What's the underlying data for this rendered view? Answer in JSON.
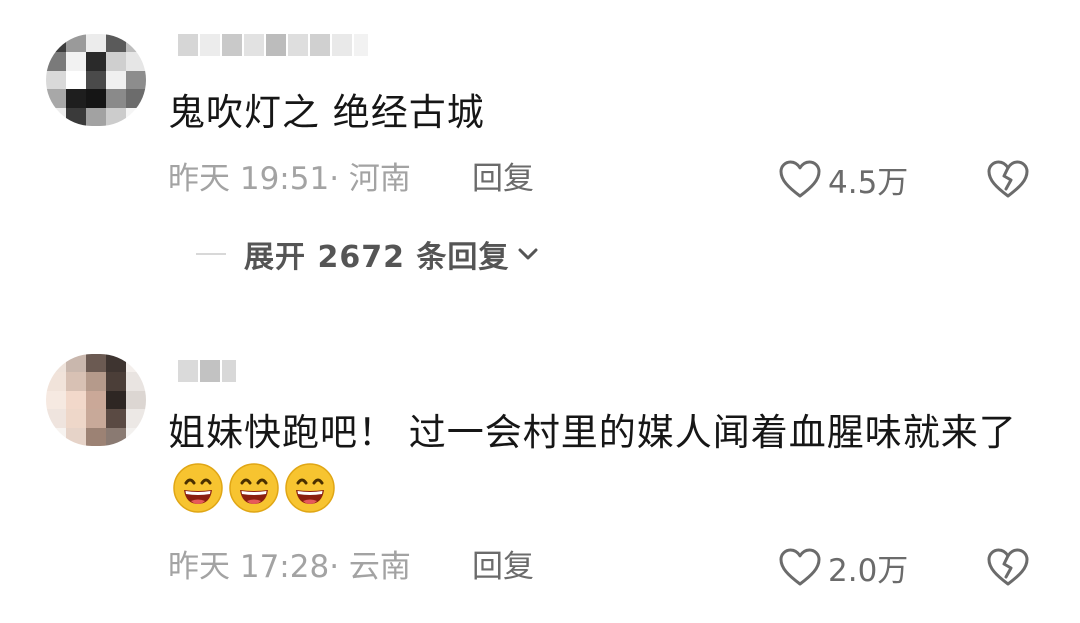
{
  "comments": [
    {
      "text": "鬼吹灯之 绝经古城",
      "time_location": "昨天 19:51· 河南",
      "reply_label": "回复",
      "like_count": "4.5万",
      "expand_label": "展开 2672 条回复"
    },
    {
      "text": "姐妹快跑吧！ 过一会村里的媒人闻着血腥味就来了",
      "emojis": [
        "grinning-face",
        "grinning-face",
        "grinning-face"
      ],
      "time_location": "昨天 17:28· 云南",
      "reply_label": "回复",
      "like_count": "2.0万"
    }
  ],
  "colors": {
    "text": "#161616",
    "meta": "#a3a3a3",
    "action": "#6b6b6b",
    "emoji_face": "#f7c430"
  },
  "icons": [
    "heart-outline-icon",
    "broken-heart-icon",
    "chevron-down-icon"
  ]
}
